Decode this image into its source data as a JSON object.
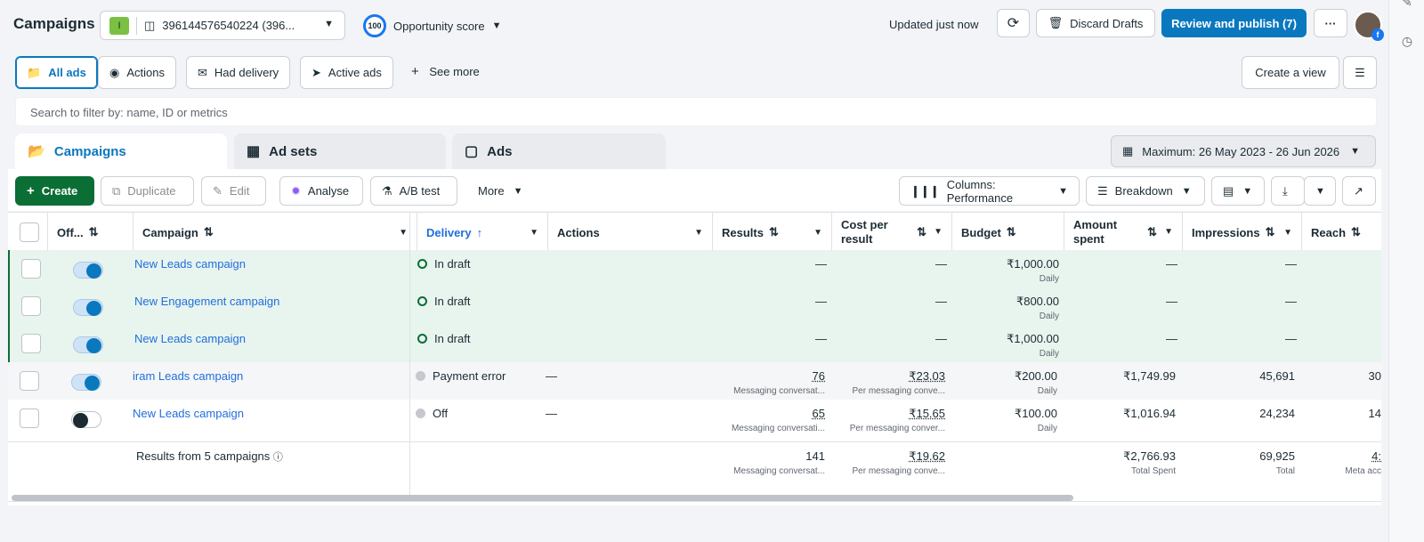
{
  "header": {
    "title": "Campaigns",
    "account_badge": "I",
    "account_name": "396144576540224 (396...",
    "opportunity_score": "100",
    "opportunity_label": "Opportunity score",
    "updated": "Updated just now",
    "discard": "Discard Drafts",
    "review": "Review and publish (7)",
    "more": "···"
  },
  "filters": {
    "chips": [
      "All ads",
      "Actions",
      "Had delivery",
      "Active ads"
    ],
    "see_more": "See more",
    "create_view": "Create a view",
    "search_placeholder": "Search to filter by: name, ID or metrics"
  },
  "tabs": [
    "Campaigns",
    "Ad sets",
    "Ads"
  ],
  "date_range": "Maximum: 26 May 2023 - 26 Jun 2026",
  "toolbar": {
    "create": "Create",
    "duplicate": "Duplicate",
    "edit": "Edit",
    "analyse": "Analyse",
    "ab_test": "A/B test",
    "more": "More",
    "columns": "Columns: Performance",
    "breakdown": "Breakdown"
  },
  "columns": [
    "Off...",
    "Campaign",
    "Delivery",
    "Actions",
    "Results",
    "Cost per result",
    "Budget",
    "Amount spent",
    "Impressions",
    "Reach"
  ],
  "rows": [
    {
      "name": "New Leads campaign",
      "toggle": "on",
      "delivery": "In draft",
      "actions": "",
      "results": "—",
      "results_sub": "",
      "cpr": "—",
      "cpr_sub": "",
      "budget": "₹1,000.00",
      "budget_sub": "Daily",
      "spent": "—",
      "impressions": "—",
      "reach": ""
    },
    {
      "name": "New Engagement campaign",
      "toggle": "on",
      "delivery": "In draft",
      "actions": "",
      "results": "—",
      "results_sub": "",
      "cpr": "—",
      "cpr_sub": "",
      "budget": "₹800.00",
      "budget_sub": "Daily",
      "spent": "—",
      "impressions": "—",
      "reach": ""
    },
    {
      "name": "New Leads campaign",
      "toggle": "on",
      "delivery": "In draft",
      "actions": "",
      "results": "—",
      "results_sub": "",
      "cpr": "—",
      "cpr_sub": "",
      "budget": "₹1,000.00",
      "budget_sub": "Daily",
      "spent": "—",
      "impressions": "—",
      "reach": ""
    },
    {
      "name": "iram Leads campaign",
      "toggle": "on",
      "delivery": "Payment error",
      "actions": "—",
      "results": "76",
      "results_sub": "Messaging conversat...",
      "cpr": "₹23.03",
      "cpr_sub": "Per messaging conve...",
      "budget": "₹200.00",
      "budget_sub": "Daily",
      "spent": "₹1,749.99",
      "impressions": "45,691",
      "reach": "30"
    },
    {
      "name": "New Leads campaign",
      "toggle": "off",
      "delivery": "Off",
      "actions": "—",
      "results": "65",
      "results_sub": "Messaging conversati...",
      "cpr": "₹15.65",
      "cpr_sub": "Per messaging conver...",
      "budget": "₹100.00",
      "budget_sub": "Daily",
      "spent": "₹1,016.94",
      "impressions": "24,234",
      "reach": "14"
    }
  ],
  "summary": {
    "label": "Results from 5 campaigns",
    "results": "141",
    "results_sub": "Messaging conversat...",
    "cpr": "₹19.62",
    "cpr_sub": "Per messaging conve...",
    "spent": "₹2,766.93",
    "spent_sub": "Total Spent",
    "impressions": "69,925",
    "impressions_sub": "Total",
    "reach": "4:",
    "reach_sub": "Meta acc"
  },
  "colors": {
    "primary": "#0a78be",
    "create_green": "#0b6e35",
    "draft_row": "#e8f4ee",
    "link": "#216fdb"
  }
}
